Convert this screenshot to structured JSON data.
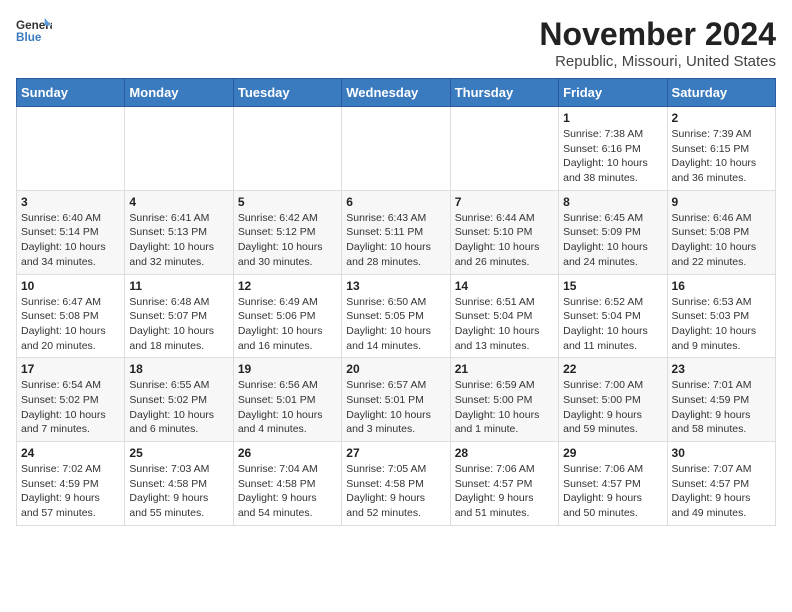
{
  "logo": {
    "text_general": "General",
    "text_blue": "Blue"
  },
  "title": "November 2024",
  "subtitle": "Republic, Missouri, United States",
  "days_of_week": [
    "Sunday",
    "Monday",
    "Tuesday",
    "Wednesday",
    "Thursday",
    "Friday",
    "Saturday"
  ],
  "weeks": [
    [
      {
        "day": "",
        "info": ""
      },
      {
        "day": "",
        "info": ""
      },
      {
        "day": "",
        "info": ""
      },
      {
        "day": "",
        "info": ""
      },
      {
        "day": "",
        "info": ""
      },
      {
        "day": "1",
        "info": "Sunrise: 7:38 AM\nSunset: 6:16 PM\nDaylight: 10 hours\nand 38 minutes."
      },
      {
        "day": "2",
        "info": "Sunrise: 7:39 AM\nSunset: 6:15 PM\nDaylight: 10 hours\nand 36 minutes."
      }
    ],
    [
      {
        "day": "3",
        "info": "Sunrise: 6:40 AM\nSunset: 5:14 PM\nDaylight: 10 hours\nand 34 minutes."
      },
      {
        "day": "4",
        "info": "Sunrise: 6:41 AM\nSunset: 5:13 PM\nDaylight: 10 hours\nand 32 minutes."
      },
      {
        "day": "5",
        "info": "Sunrise: 6:42 AM\nSunset: 5:12 PM\nDaylight: 10 hours\nand 30 minutes."
      },
      {
        "day": "6",
        "info": "Sunrise: 6:43 AM\nSunset: 5:11 PM\nDaylight: 10 hours\nand 28 minutes."
      },
      {
        "day": "7",
        "info": "Sunrise: 6:44 AM\nSunset: 5:10 PM\nDaylight: 10 hours\nand 26 minutes."
      },
      {
        "day": "8",
        "info": "Sunrise: 6:45 AM\nSunset: 5:09 PM\nDaylight: 10 hours\nand 24 minutes."
      },
      {
        "day": "9",
        "info": "Sunrise: 6:46 AM\nSunset: 5:08 PM\nDaylight: 10 hours\nand 22 minutes."
      }
    ],
    [
      {
        "day": "10",
        "info": "Sunrise: 6:47 AM\nSunset: 5:08 PM\nDaylight: 10 hours\nand 20 minutes."
      },
      {
        "day": "11",
        "info": "Sunrise: 6:48 AM\nSunset: 5:07 PM\nDaylight: 10 hours\nand 18 minutes."
      },
      {
        "day": "12",
        "info": "Sunrise: 6:49 AM\nSunset: 5:06 PM\nDaylight: 10 hours\nand 16 minutes."
      },
      {
        "day": "13",
        "info": "Sunrise: 6:50 AM\nSunset: 5:05 PM\nDaylight: 10 hours\nand 14 minutes."
      },
      {
        "day": "14",
        "info": "Sunrise: 6:51 AM\nSunset: 5:04 PM\nDaylight: 10 hours\nand 13 minutes."
      },
      {
        "day": "15",
        "info": "Sunrise: 6:52 AM\nSunset: 5:04 PM\nDaylight: 10 hours\nand 11 minutes."
      },
      {
        "day": "16",
        "info": "Sunrise: 6:53 AM\nSunset: 5:03 PM\nDaylight: 10 hours\nand 9 minutes."
      }
    ],
    [
      {
        "day": "17",
        "info": "Sunrise: 6:54 AM\nSunset: 5:02 PM\nDaylight: 10 hours\nand 7 minutes."
      },
      {
        "day": "18",
        "info": "Sunrise: 6:55 AM\nSunset: 5:02 PM\nDaylight: 10 hours\nand 6 minutes."
      },
      {
        "day": "19",
        "info": "Sunrise: 6:56 AM\nSunset: 5:01 PM\nDaylight: 10 hours\nand 4 minutes."
      },
      {
        "day": "20",
        "info": "Sunrise: 6:57 AM\nSunset: 5:01 PM\nDaylight: 10 hours\nand 3 minutes."
      },
      {
        "day": "21",
        "info": "Sunrise: 6:59 AM\nSunset: 5:00 PM\nDaylight: 10 hours\nand 1 minute."
      },
      {
        "day": "22",
        "info": "Sunrise: 7:00 AM\nSunset: 5:00 PM\nDaylight: 9 hours\nand 59 minutes."
      },
      {
        "day": "23",
        "info": "Sunrise: 7:01 AM\nSunset: 4:59 PM\nDaylight: 9 hours\nand 58 minutes."
      }
    ],
    [
      {
        "day": "24",
        "info": "Sunrise: 7:02 AM\nSunset: 4:59 PM\nDaylight: 9 hours\nand 57 minutes."
      },
      {
        "day": "25",
        "info": "Sunrise: 7:03 AM\nSunset: 4:58 PM\nDaylight: 9 hours\nand 55 minutes."
      },
      {
        "day": "26",
        "info": "Sunrise: 7:04 AM\nSunset: 4:58 PM\nDaylight: 9 hours\nand 54 minutes."
      },
      {
        "day": "27",
        "info": "Sunrise: 7:05 AM\nSunset: 4:58 PM\nDaylight: 9 hours\nand 52 minutes."
      },
      {
        "day": "28",
        "info": "Sunrise: 7:06 AM\nSunset: 4:57 PM\nDaylight: 9 hours\nand 51 minutes."
      },
      {
        "day": "29",
        "info": "Sunrise: 7:06 AM\nSunset: 4:57 PM\nDaylight: 9 hours\nand 50 minutes."
      },
      {
        "day": "30",
        "info": "Sunrise: 7:07 AM\nSunset: 4:57 PM\nDaylight: 9 hours\nand 49 minutes."
      }
    ]
  ]
}
